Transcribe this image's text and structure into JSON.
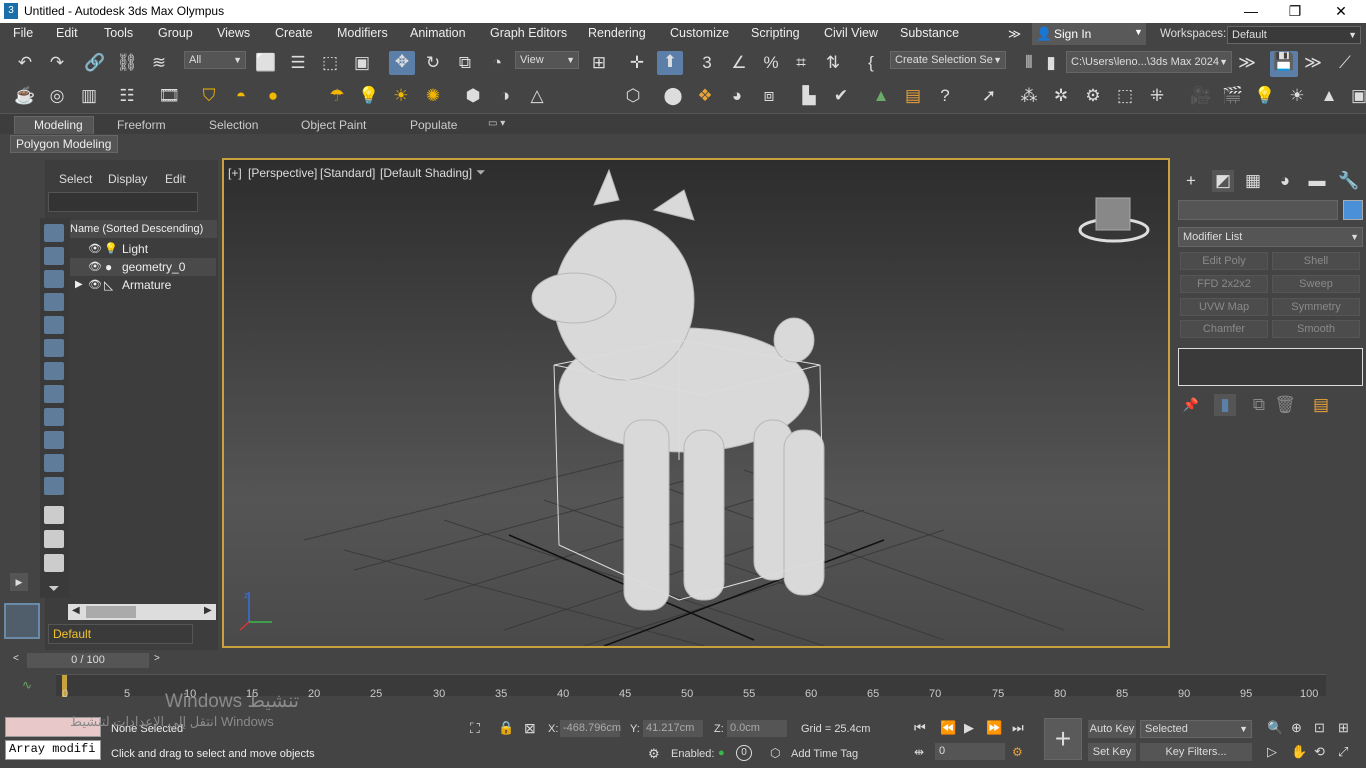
{
  "window": {
    "title": "Untitled - Autodesk 3ds Max Olympus",
    "app_icon": "3",
    "minimize": "—",
    "restore": "❐",
    "close": "✕"
  },
  "menu": [
    "File",
    "Edit",
    "Tools",
    "Group",
    "Views",
    "Create",
    "Modifiers",
    "Animation",
    "Graph Editors",
    "Rendering",
    "Customize",
    "Scripting",
    "Civil View",
    "Substance"
  ],
  "menu_more": "≫",
  "account": {
    "sign_in": "Sign In",
    "workspaces_label": "Workspaces:",
    "workspace_value": "Default"
  },
  "toolbar1": {
    "selection_filter": "All",
    "ref_coord": "View",
    "named_selection": "Create Selection Se",
    "path": "C:\\Users\\leno...\\3ds Max 2024"
  },
  "ribbon": {
    "tabs": [
      "Modeling",
      "Freeform",
      "Selection",
      "Object Paint",
      "Populate"
    ],
    "active": "Modeling",
    "sub": "Polygon Modeling"
  },
  "scene_explorer": {
    "tabs": [
      "Select",
      "Display",
      "Edit"
    ],
    "header": "Name (Sorted Descending)",
    "items": [
      "Light",
      "geometry_0",
      "Armature"
    ],
    "layer": "Default"
  },
  "viewport": {
    "label_plus": "[+]",
    "label_view": "[Perspective]",
    "label_mode": "[Standard]",
    "label_shading": "[Default Shading]"
  },
  "command_panel": {
    "modifier_list": "Modifier List",
    "buttons": [
      "Edit Poly",
      "Shell",
      "FFD 2x2x2",
      "Sweep",
      "UVW Map",
      "Symmetry",
      "Chamfer",
      "Smooth"
    ],
    "color": "#4a90d9"
  },
  "timeline": {
    "frame": "0 / 100",
    "ticks": [
      "0",
      "5",
      "10",
      "15",
      "20",
      "25",
      "30",
      "35",
      "40",
      "45",
      "50",
      "55",
      "60",
      "65",
      "70",
      "75",
      "80",
      "85",
      "90",
      "95",
      "100"
    ]
  },
  "status": {
    "script": "Array modifi",
    "selected": "None Selected",
    "hint": "Click and drag to select and move objects",
    "x_label": "X:",
    "x_val": "-468.796cm",
    "y_label": "Y:",
    "y_val": "41.217cm",
    "z_label": "Z:",
    "z_val": "0.0cm",
    "grid": "Grid = 25.4cm",
    "enabled": "Enabled:",
    "enabled_val": "0",
    "add_time_tag": "Add Time Tag",
    "auto_key": "Auto Key",
    "set_key": "Set Key",
    "key_mode": "Selected",
    "key_filters": "Key Filters...",
    "frame_field": "0"
  },
  "watermark": {
    "line1": "Windows تنشيط",
    "line2": "انتقل إلى الإعدادات لتنشيط Windows"
  }
}
